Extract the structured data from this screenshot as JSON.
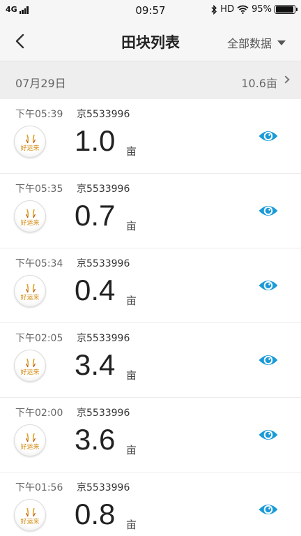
{
  "status": {
    "network": "4G",
    "time": "09:57",
    "bluetooth_icon": "bluetooth-icon",
    "hd": "HD",
    "wifi_icon": "wifi-icon",
    "battery": "95%"
  },
  "nav": {
    "back_icon": "chevron-left-icon",
    "title": "田块列表",
    "filter_label": "全部数据"
  },
  "group": {
    "date": "07月29日",
    "total": "10.6亩"
  },
  "logo_text": "好运来",
  "colors": {
    "accent": "#1a9bd7",
    "logo": "#d48a10"
  },
  "rows": [
    {
      "time": "下午05:39",
      "plate": "京5533996",
      "area": "1.0",
      "unit": "亩"
    },
    {
      "time": "下午05:35",
      "plate": "京5533996",
      "area": "0.7",
      "unit": "亩"
    },
    {
      "time": "下午05:34",
      "plate": "京5533996",
      "area": "0.4",
      "unit": "亩"
    },
    {
      "time": "下午02:05",
      "plate": "京5533996",
      "area": "3.4",
      "unit": "亩"
    },
    {
      "time": "下午02:00",
      "plate": "京5533996",
      "area": "3.6",
      "unit": "亩"
    },
    {
      "time": "下午01:56",
      "plate": "京5533996",
      "area": "0.8",
      "unit": "亩"
    }
  ]
}
